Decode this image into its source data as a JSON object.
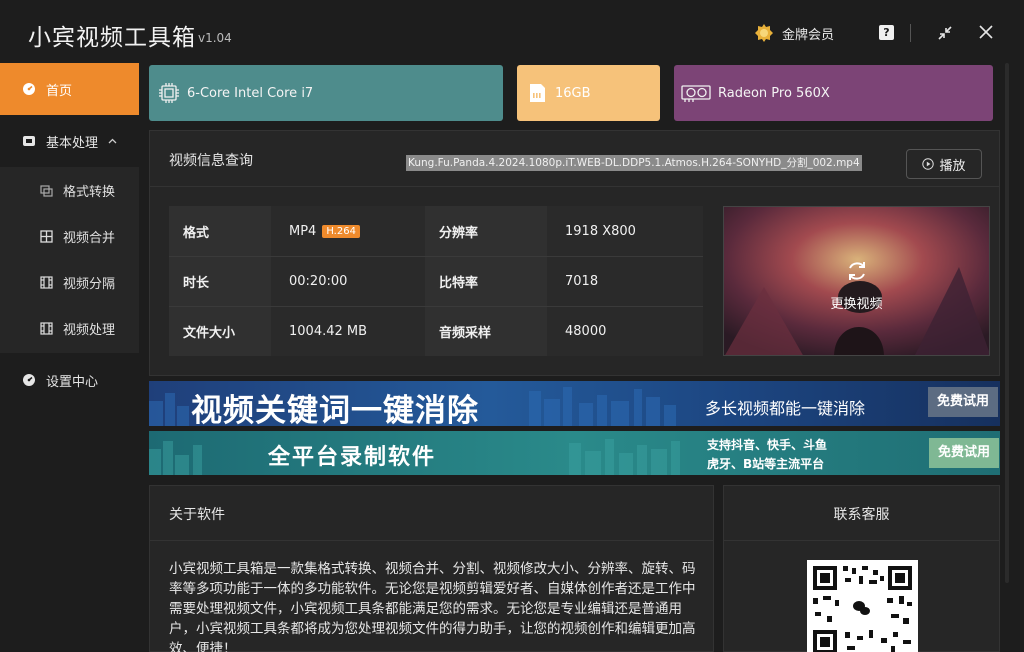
{
  "app": {
    "title": "小宾视频工具箱",
    "version": "v1.04"
  },
  "titlebar": {
    "vip_label": "金牌会员",
    "help_glyph": "?"
  },
  "sidebar": {
    "items": [
      {
        "label": "首页",
        "icon": "dashboard-icon",
        "active": true
      },
      {
        "label": "基本处理",
        "icon": "tv-icon",
        "expanded": true
      },
      {
        "label": "设置中心",
        "icon": "settings-icon"
      }
    ],
    "sub_items": [
      {
        "label": "格式转换",
        "icon": "convert-icon"
      },
      {
        "label": "视频合并",
        "icon": "merge-icon"
      },
      {
        "label": "视频分隔",
        "icon": "film-icon"
      },
      {
        "label": "视频处理",
        "icon": "film-icon"
      }
    ]
  },
  "hardware": {
    "cpu": "6-Core Intel Core i7",
    "memory": "16GB",
    "gpu": "Radeon Pro 560X"
  },
  "video_info": {
    "title": "视频信息查询",
    "filename": "Kung.Fu.Panda.4.2024.1080p.iT.WEB-DL.DDP5.1.Atmos.H.264-SONYHD_分割_002.mp4",
    "play_label": "播放",
    "change_label": "更换视频",
    "rows": [
      {
        "k1": "格式",
        "v1": "MP4",
        "badge": "H.264",
        "k2": "分辨率",
        "v2": "1918 X800"
      },
      {
        "k1": "时长",
        "v1": "00:20:00",
        "k2": "比特率",
        "v2": "7018"
      },
      {
        "k1": "文件大小",
        "v1": "1004.42 MB",
        "k2": "音频采样",
        "v2": "48000"
      }
    ]
  },
  "banners": {
    "b1": {
      "main": "视频关键词一键消除",
      "sub": "多长视频都能一键消除",
      "button": "免费试用"
    },
    "b2": {
      "main": "全平台录制软件",
      "sub1": "支持抖音、快手、斗鱼",
      "sub2": "虎牙、B站等主流平台",
      "button": "免费试用"
    }
  },
  "about": {
    "title": "关于软件",
    "text": "小宾视频工具箱是一款集格式转换、视频合并、分割、视频修改大小、分辨率、旋转、码率等多项功能于一体的多功能软件。无论您是视频剪辑爱好者、自媒体创作者还是工作中需要处理视频文件，小宾视频工具条都能满足您的需求。无论您是专业编辑还是普通用户，小宾视频工具条都将成为您处理视频文件的得力助手，让您的视频创作和编辑更加高效、便捷！"
  },
  "contact": {
    "title": "联系客服"
  },
  "colors": {
    "accent": "#ee8a2c",
    "cpu": "#4e8c8c",
    "memory": "#f6c27a",
    "gpu": "#7c4476"
  }
}
